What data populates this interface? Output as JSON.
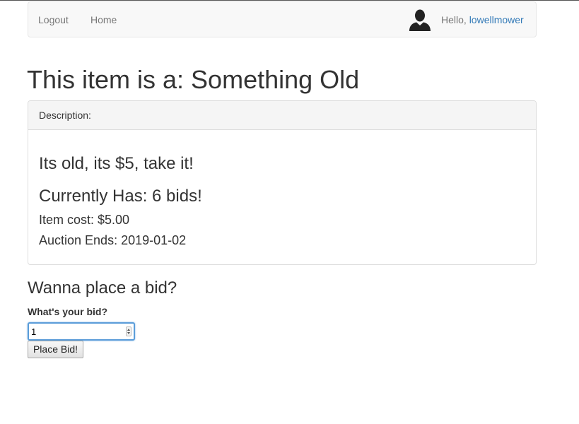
{
  "nav": {
    "logout_label": "Logout",
    "home_label": "Home",
    "greeting": "Hello, ",
    "username": "lowellmower"
  },
  "page": {
    "title": "This item is a: Something Old"
  },
  "item_panel": {
    "heading": "Description:",
    "description": "Its old, its $5, take it!",
    "bids": "Currently Has: 6 bids!",
    "cost": "Item cost: $5.00",
    "auction_ends": "Auction Ends: 2019-01-02"
  },
  "bid_form": {
    "heading": "Wanna place a bid?",
    "label": "What's your bid?",
    "value": "1",
    "button_label": "Place Bid!"
  },
  "colors": {
    "link": "#337ab7",
    "navbar_bg": "#f8f8f8",
    "focus_border": "#5b9dd9"
  }
}
